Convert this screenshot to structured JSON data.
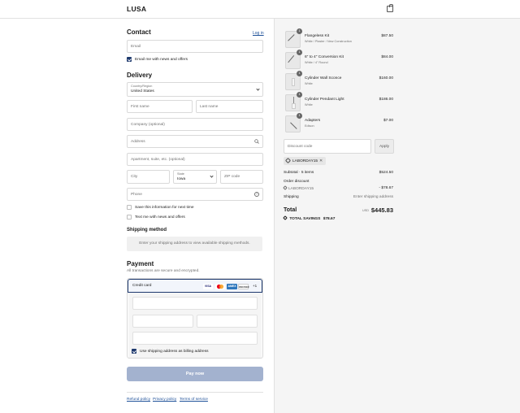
{
  "header": {
    "logo": "LUSA",
    "cart_icon": "bag-icon"
  },
  "contact": {
    "title": "Contact",
    "login_link": "Log in",
    "email_placeholder": "Email",
    "email_news_label": "Email me with news and offers",
    "email_news_checked": true
  },
  "delivery": {
    "title": "Delivery",
    "country_label": "Country/Region",
    "country_value": "United States",
    "first_name": "First name",
    "last_name": "Last name",
    "company": "Company (optional)",
    "address": "Address",
    "apartment": "Apartment, suite, etc. (optional)",
    "city": "City",
    "state_label": "State",
    "state_value": "Iowa",
    "zip": "ZIP code",
    "phone": "Phone",
    "save_info_label": "Save this information for next time",
    "text_news_label": "Text me with news and offers"
  },
  "shipping": {
    "title": "Shipping method",
    "message": "Enter your shipping address to view available shipping methods."
  },
  "payment": {
    "title": "Payment",
    "subtitle": "All transactions are secure and encrypted.",
    "method_label": "Credit card",
    "cards": [
      "VISA",
      "MC",
      "AMEX",
      "DISCOVER"
    ],
    "more_cards": "+1",
    "billing_label": "Use shipping address as billing address",
    "billing_checked": true,
    "pay_button": "Pay now"
  },
  "footer": {
    "refund": "Refund policy",
    "privacy": "Privacy policy",
    "terms": "Terms of service"
  },
  "order": {
    "items": [
      {
        "qty": "1",
        "name": "Flangeless Kit",
        "variant": "White / Plaster / New Construction",
        "price": "$87.50"
      },
      {
        "qty": "1",
        "name": "6\" to 4\" Conversion Kit",
        "variant": "White / 4\" Round",
        "price": "$84.00"
      },
      {
        "qty": "1",
        "name": "Cylinder Wall Sconce",
        "variant": "White",
        "price": "$160.00"
      },
      {
        "qty": "1",
        "name": "Cylinder Pendant Light",
        "variant": "White",
        "price": "$186.00"
      },
      {
        "qty": "1",
        "name": "Adapters",
        "variant": "Edison",
        "price": "$7.00"
      }
    ],
    "discount_placeholder": "Discount code",
    "apply_button": "Apply",
    "applied_code": "LABORDAY15",
    "subtotal_label": "Subtotal · 5 items",
    "subtotal_value": "$524.50",
    "order_discount_label": "Order discount",
    "discount_code_label": "LABORDAY15",
    "discount_value": "- $78.67",
    "shipping_label": "Shipping",
    "shipping_value": "Enter shipping address",
    "total_label": "Total",
    "currency": "USD",
    "total_value": "$445.83",
    "savings_label": "TOTAL SAVINGS",
    "savings_value": "$78.67"
  }
}
